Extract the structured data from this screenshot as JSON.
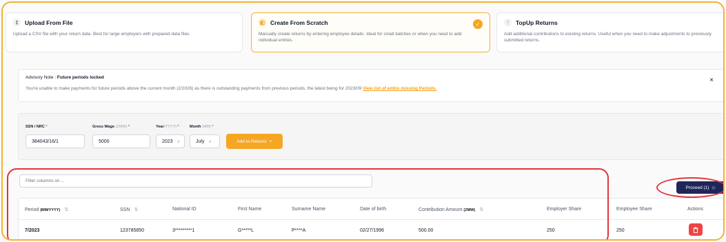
{
  "cards": [
    {
      "title": "Upload From File",
      "desc": "Upload a CSV file with your return data. Best for large employers with prepared data files.",
      "icon": "upload-icon"
    },
    {
      "title": "Create From Scratch",
      "desc": "Manually create returns by entering employee details. Ideal for small batches or when you need to add individual entries.",
      "icon": "document-icon",
      "selected": true
    },
    {
      "title": "TopUp Returns",
      "desc": "Add additional contributions to existing returns. Useful when you need to make adjustments to previously submitted returns.",
      "icon": "arrow-up-icon"
    }
  ],
  "advisory": {
    "label": "Advisory Note : ",
    "title": "Future periods locked",
    "message": "You're unable to make payments for future periods above the current month (2/2026) as there is outstanding payments from previous periods, the latest being for 2023/09 ",
    "link": "View list of entire missing Periods.",
    "close": "×"
  },
  "form": {
    "ssn_label": "SSN / NRC",
    "ssn_value": "384043/16/1",
    "wage_label": "Gross Wage",
    "wage_unit": "(ZMW)",
    "wage_value": "5000",
    "year_label": "Year",
    "year_unit": "(YYYY)",
    "year_value": "2023",
    "month_label": "Month",
    "month_unit": "(MM)",
    "month_value": "July",
    "required_mark": "*",
    "add_button": "Add to Returns",
    "add_icon": "+"
  },
  "filter": {
    "placeholder": "Filter columns on ..."
  },
  "proceed": {
    "label": "Proceed (1)",
    "icon": "◇"
  },
  "table": {
    "headers": {
      "period": "Period",
      "period_unit": "(MM/YYYY)",
      "ssn": "SSN",
      "national_id": "National ID",
      "first_name": "First Name",
      "surname": "Surname Name",
      "dob": "Date of birth",
      "contribution": "Contribution Amount",
      "contribution_unit": "(ZMW)",
      "employer_share": "Employer Share",
      "employee_share": "Employee Share",
      "actions": "Actions"
    },
    "sort_icon": "⇅",
    "rows": [
      {
        "period": "7/2023",
        "ssn": "123785850",
        "national_id": "3*********1",
        "first_name": "G*****L",
        "surname": "P****A",
        "dob": "02/27/1996",
        "contribution": "500.00",
        "employer_share": "250",
        "employee_share": "250"
      }
    ]
  },
  "colors": {
    "accent": "#f5a623",
    "primary": "#1e2659",
    "danger": "#ef4444",
    "highlight_ring": "#e5323a"
  }
}
